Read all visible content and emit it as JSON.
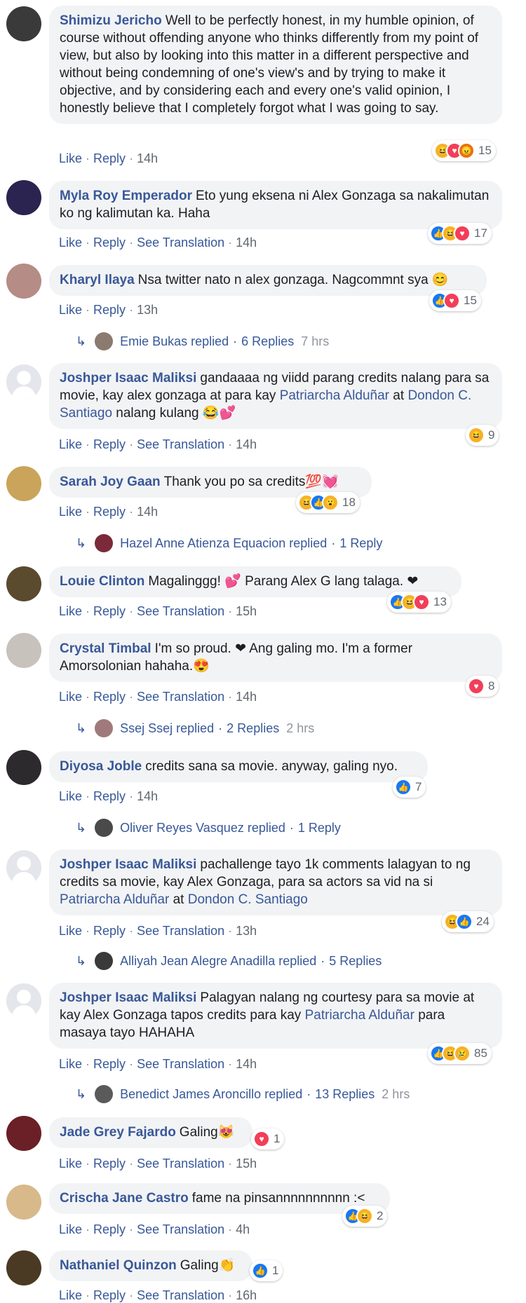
{
  "comments": [
    {
      "author": "Shimizu Jericho",
      "text": "Well to be perfectly honest, in my humble opinion, of course without offending anyone who thinks differently from my point of view, but also by looking into this matter in a different perspective and without being condemning of one's view's and by trying to make it objective, and by considering each and every one's valid opinion, I honestly believe that I completely forgot what I was going to say.",
      "like": "Like",
      "reply": "Reply",
      "time": "14h",
      "reactions": {
        "icons": [
          "haha-icon",
          "love-icon",
          "angry-icon"
        ],
        "count": "15"
      },
      "avatar_color": "#3a3a3a"
    },
    {
      "author": "Myla Roy Emperador",
      "text": "Eto yung eksena ni Alex Gonzaga sa nakalimutan ko ng kalimutan ka. Haha",
      "like": "Like",
      "reply": "Reply",
      "translate": "See Translation",
      "time": "14h",
      "reactions": {
        "icons": [
          "like-icon",
          "haha-icon",
          "love-icon"
        ],
        "count": "17"
      },
      "avatar_color": "#2b2350"
    },
    {
      "author": "Kharyl Ilaya",
      "text": "Nsa twitter nato n alex gonzaga. Nagcommnt sya 😊",
      "like": "Like",
      "reply": "Reply",
      "time": "13h",
      "reactions": {
        "icons": [
          "like-icon",
          "love-icon"
        ],
        "count": "15"
      },
      "replies": {
        "name": "Emie Bukas replied",
        "count": "6 Replies",
        "time": "7 hrs"
      },
      "avatar_color": "#b58c86"
    },
    {
      "author": "Joshper Isaac Maliksi",
      "text": "gandaaaa ng viidd parang credits nalang para sa movie, kay alex gonzaga at para kay",
      "mention1": "Patriarcha Alduñar",
      "mid": "at",
      "mention2": "Dondon C. Santiago",
      "tail": "nalang kulang 😂💕",
      "like": "Like",
      "reply": "Reply",
      "translate": "See Translation",
      "time": "14h",
      "reactions": {
        "icons": [
          "haha-icon"
        ],
        "count": "9"
      }
    },
    {
      "author": "Sarah Joy Gaan",
      "text": "Thank you po sa credits💯💓",
      "like": "Like",
      "reply": "Reply",
      "time": "14h",
      "reactions": {
        "icons": [
          "haha-icon",
          "like-icon",
          "wow-icon"
        ],
        "count": "18"
      },
      "replies": {
        "name": "Hazel Anne Atienza Equacion replied",
        "count": "1 Reply",
        "time": ""
      },
      "avatar_color": "#c9a45a"
    },
    {
      "author": "Louie Clinton",
      "text": "Magalinggg! 💕 Parang Alex G lang talaga. ❤",
      "like": "Like",
      "reply": "Reply",
      "translate": "See Translation",
      "time": "15h",
      "reactions": {
        "icons": [
          "like-icon",
          "haha-icon",
          "love-icon"
        ],
        "count": "13"
      },
      "avatar_color": "#5a4a2e"
    },
    {
      "author": "Crystal Timbal",
      "text": "I'm so proud. ❤ Ang galing mo. I'm a former Amorsolonian hahaha.😍",
      "like": "Like",
      "reply": "Reply",
      "translate": "See Translation",
      "time": "14h",
      "reactions": {
        "icons": [
          "love-icon"
        ],
        "count": "8"
      },
      "replies": {
        "name": "Ssej Ssej replied",
        "count": "2 Replies",
        "time": "2 hrs"
      },
      "avatar_color": "#c8c2bc"
    },
    {
      "author": "Diyosa Joble",
      "text": "credits sana sa movie. anyway, galing nyo.",
      "like": "Like",
      "reply": "Reply",
      "time": "14h",
      "reactions": {
        "icons": [
          "like-icon"
        ],
        "count": "7"
      },
      "replies": {
        "name": "Oliver Reyes Vasquez replied",
        "count": "1 Reply",
        "time": ""
      },
      "avatar_color": "#2d2a2e"
    },
    {
      "author": "Joshper Isaac Maliksi",
      "text": "pachallenge tayo 1k comments lalagyan to ng credits sa movie, kay Alex Gonzaga, para sa actors sa vid na si",
      "mention1": "Patriarcha Alduñar",
      "mid": "at",
      "mention2": "Dondon C. Santiago",
      "tail": "",
      "like": "Like",
      "reply": "Reply",
      "translate": "See Translation",
      "time": "13h",
      "reactions": {
        "icons": [
          "haha-icon",
          "like-icon"
        ],
        "count": "24"
      },
      "replies": {
        "name": "Alliyah Jean Alegre Anadilla replied",
        "count": "5 Replies",
        "time": ""
      }
    },
    {
      "author": "Joshper Isaac Maliksi",
      "text": "Palagyan nalang ng courtesy para sa movie at kay Alex Gonzaga tapos credits para kay",
      "mention1": "Patriarcha Alduñar",
      "mid": "para masaya tayo HAHAHA",
      "mention2": "",
      "tail": "",
      "like": "Like",
      "reply": "Reply",
      "translate": "See Translation",
      "time": "14h",
      "reactions": {
        "icons": [
          "like-icon",
          "haha-icon",
          "sad-icon"
        ],
        "count": "85"
      },
      "replies": {
        "name": "Benedict James Aroncillo replied",
        "count": "13 Replies",
        "time": "2 hrs"
      }
    },
    {
      "author": "Jade Grey Fajardo",
      "text": "Galing😻",
      "like": "Like",
      "reply": "Reply",
      "translate": "See Translation",
      "time": "15h",
      "reactions": {
        "icons": [
          "love-icon"
        ],
        "count": "1"
      },
      "avatar_color": "#6b1f26"
    },
    {
      "author": "Crischa Jane Castro",
      "text": "fame na pinsannnnnnnnnn :<",
      "like": "Like",
      "reply": "Reply",
      "translate": "See Translation",
      "time": "4h",
      "reactions": {
        "icons": [
          "like-icon",
          "haha-icon"
        ],
        "count": "2"
      },
      "avatar_color": "#d8b98a"
    },
    {
      "author": "Nathaniel Quinzon",
      "text": "Galing👏",
      "like": "Like",
      "reply": "Reply",
      "translate": "See Translation",
      "time": "16h",
      "reactions": {
        "icons": [
          "like-icon"
        ],
        "count": "1"
      },
      "avatar_color": "#4a3a24"
    }
  ],
  "reply_colors": {
    "c2": "#8a7a70",
    "c4": "#7a2a3a",
    "c6": "#a07a7a",
    "c7": "#4a4a4a",
    "c8": "#3a3a3a",
    "c9": "#5a5a5a"
  },
  "separator": "·"
}
